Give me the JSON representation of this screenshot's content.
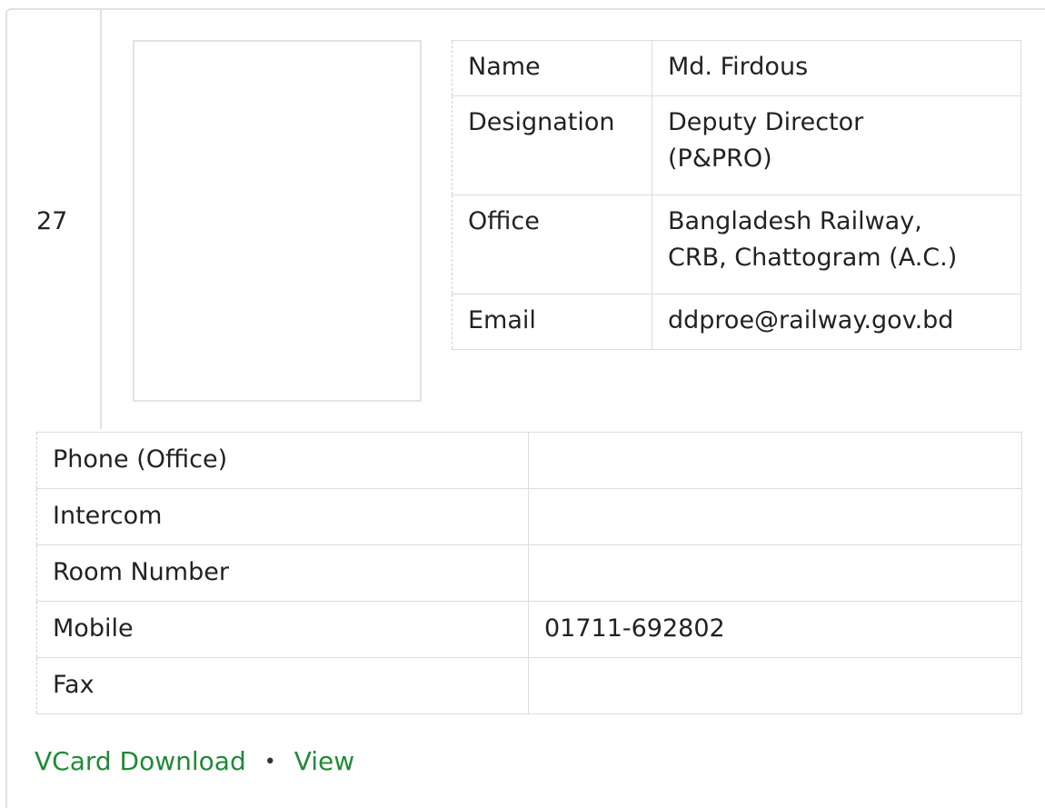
{
  "serial": "27",
  "info": {
    "rows": [
      {
        "label": "Name",
        "value": "Md. Firdous"
      },
      {
        "label": "Designation",
        "value_lines": [
          "Deputy Director",
          "(P&PRO)"
        ]
      },
      {
        "label": "Office",
        "value_lines": [
          "Bangladesh Railway,",
          "CRB, Chattogram (A.C.)"
        ]
      },
      {
        "label": "Email",
        "value": "ddproe@railway.gov.bd"
      }
    ]
  },
  "contact": {
    "rows": [
      {
        "label": "Phone (Office)",
        "value": ""
      },
      {
        "label": "Intercom",
        "value": ""
      },
      {
        "label": "Room Number",
        "value": ""
      },
      {
        "label": "Mobile",
        "value": "01711-692802"
      },
      {
        "label": "Fax",
        "value": ""
      }
    ]
  },
  "links": {
    "vcard_download": "VCard Download",
    "separator": "•",
    "view": "View",
    "color": "#1f8a36"
  }
}
